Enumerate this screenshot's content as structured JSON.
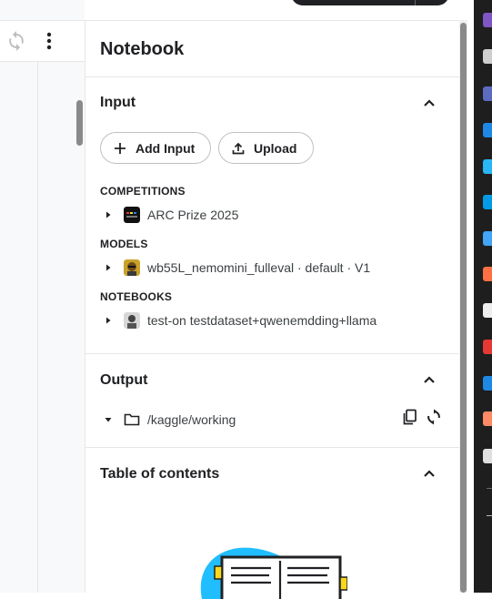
{
  "panel": {
    "title": "Notebook"
  },
  "input": {
    "title": "Input",
    "add_input_label": "Add Input",
    "upload_label": "Upload",
    "competitions_heading": "COMPETITIONS",
    "competitions": [
      {
        "label": "ARC Prize 2025",
        "icon": "arc-prize-thumbnail"
      }
    ],
    "models_heading": "MODELS",
    "models": [
      {
        "label": "wb55L_nemomini_fulleval · default · V1",
        "icon": "model-avatar"
      }
    ],
    "notebooks_heading": "NOTEBOOKS",
    "notebooks": [
      {
        "label": "test-on testdataset+qwenemdding+llama",
        "icon": "notebook-avatar"
      }
    ]
  },
  "output": {
    "title": "Output",
    "path": "/kaggle/working"
  },
  "toc": {
    "title": "Table of contents"
  },
  "colors": {
    "accent_blue": "#20beff",
    "text": "#202124",
    "border": "#bdc1c6"
  }
}
